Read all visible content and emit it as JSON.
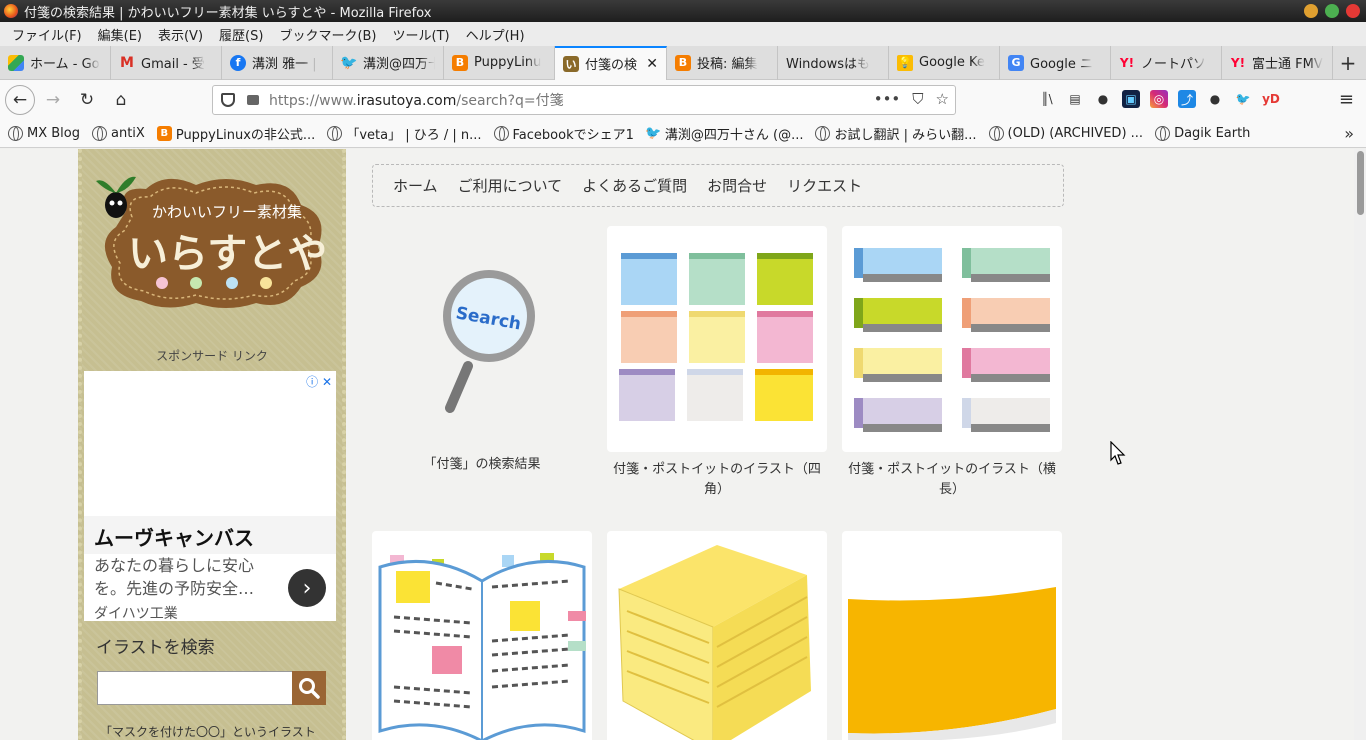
{
  "window": {
    "title": "付箋の検索結果 | かわいいフリー素材集 いらすとや - Mozilla Firefox"
  },
  "menu": [
    "ファイル(F)",
    "編集(E)",
    "表示(V)",
    "履歴(S)",
    "ブックマーク(B)",
    "ツール(T)",
    "ヘルプ(H)"
  ],
  "tabs": [
    {
      "label": "ホーム - Go",
      "icon": "google-drive-icon",
      "color": "#fbbc04"
    },
    {
      "label": "Gmail - 受",
      "icon": "gmail-icon",
      "color": "#d93025"
    },
    {
      "label": "溝渕 雅一 |",
      "icon": "facebook-icon",
      "color": "#1877f2"
    },
    {
      "label": "溝渕@四万十",
      "icon": "twitter-icon",
      "color": "#1da1f2"
    },
    {
      "label": "PuppyLinu",
      "icon": "blogger-icon",
      "color": "#f57d00"
    },
    {
      "label": "付箋の検",
      "icon": "irasutoya-icon",
      "color": "#8a6a2a",
      "active": true
    },
    {
      "label": "投稿: 編集",
      "icon": "blogger-icon",
      "color": "#f57d00"
    },
    {
      "label": "Windowsはも",
      "icon": "",
      "color": ""
    },
    {
      "label": "Google Ke",
      "icon": "google-keep-icon",
      "color": "#fbbc04"
    },
    {
      "label": "Google ニ",
      "icon": "google-news-icon",
      "color": "#4285f4"
    },
    {
      "label": "ノートパソ",
      "icon": "yahoo-icon",
      "color": "#ff0033"
    },
    {
      "label": "富士通 FMV",
      "icon": "yahoo-icon",
      "color": "#ff0033"
    }
  ],
  "urlbar": {
    "prefix": "https://www.",
    "domain": "irasutoya.com",
    "path": "/search?q=付箋"
  },
  "bookmarks": [
    {
      "label": "MX Blog",
      "icon": "globe-icon"
    },
    {
      "label": "antiX",
      "icon": "globe-icon"
    },
    {
      "label": "PuppyLinuxの非公式...",
      "icon": "blogger-icon"
    },
    {
      "label": "「veta」 | ひろ / | n...",
      "icon": "globe-icon"
    },
    {
      "label": "Facebookでシェア1",
      "icon": "globe-icon"
    },
    {
      "label": "溝渕@四万十さん (@...",
      "icon": "twitter-icon"
    },
    {
      "label": "お試し翻訳 | みらい翻...",
      "icon": "globe-icon"
    },
    {
      "label": "(OLD) (ARCHIVED) ...",
      "icon": "globe-icon"
    },
    {
      "label": "Dagik Earth",
      "icon": "globe-icon"
    }
  ],
  "sidebar": {
    "logo_small": "かわいいフリー素材集",
    "logo_big": "いらすとや",
    "sponsor": "スポンサード リンク",
    "ad": {
      "title": "ムーヴキャンバス",
      "desc": "あなたの暮らしに安心を。先進の予防安全…",
      "advertiser": "ダイハツ工業"
    },
    "search_heading": "イラストを検索",
    "note": "「マスクを付けた〇〇」というイラスト"
  },
  "site_nav": [
    "ホーム",
    "ご利用について",
    "よくあるご質問",
    "お問合せ",
    "リクエスト"
  ],
  "search_icon_text": "Search",
  "results": [
    {
      "caption": "「付箋」の検索結果"
    },
    {
      "caption": "付箋・ポストイットのイラスト（四角）"
    },
    {
      "caption": "付箋・ポストイットのイラスト（横長）"
    }
  ],
  "colors": {
    "accent": "#0a84ff",
    "brand": "#9a6534"
  }
}
